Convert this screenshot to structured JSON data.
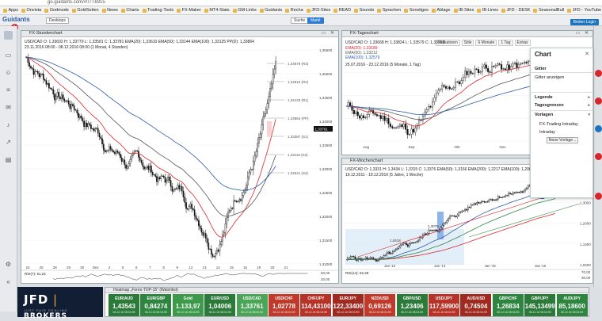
{
  "browser": {
    "url": "go.guidants.com/#!/7T6915",
    "bookmarks": [
      "Apps",
      "Onvista",
      "Godmode",
      "GoldSeiten",
      "News",
      "Charts",
      "Trading-Tools",
      "FX-Maker",
      "MT4-Stats",
      "GM-Links",
      "Guidants",
      "Recha",
      "JFD-Sites",
      "READ",
      "Sounds",
      "Sprachen",
      "Sonstiges",
      "Ablage",
      "IB-Sites",
      "IB-Lines",
      "JFD - DESK",
      "SeasonalBull",
      "JFD - YouTube",
      "Live - YouTube",
      "Weitere"
    ]
  },
  "app": {
    "logo": "Guidants",
    "badge": "1",
    "desktop_label": "Desktops",
    "search_label": "Suche",
    "market_label": "Markt",
    "broker_btn": "Broker Login"
  },
  "h1": {
    "title": "FX-Stundenchart",
    "line1": "USD/CAD   O: 1,33602  H: 1,33779  L: 1,33581  C: 1,33781   EMA(20): 1,33610   EMA(50): 1,33144   EMA(100): 1,33125   PP(D): 1,33864",
    "line2": "23.11.2016 08:00 - 08.12.2016 08:00   (1 Monat, 4 Stunden)",
    "levels": [
      {
        "label": "1,34879 (R3)",
        "color": "#555"
      },
      {
        "label": "1,34610 (R2)",
        "color": "#555"
      },
      {
        "label": "1,34133 (R1)",
        "color": "#555"
      },
      {
        "label": "1,33864 (PP)",
        "color": "#555"
      },
      {
        "label": "1,33387 (S1)",
        "color": "#555"
      },
      {
        "label": "1,33118 (S2)",
        "color": "#555"
      },
      {
        "label": "1,32641 (S3)",
        "color": "#555"
      }
    ],
    "yaxis": [
      "1,35500",
      "1,35000",
      "1,34500",
      "1,34000",
      "1,33500",
      "1,33000",
      "1,32500",
      "1,32000",
      "1,31500",
      "1,31000"
    ],
    "price_tag": "1,33761",
    "xaxis": [
      "24",
      "25",
      "28",
      "29",
      "30",
      "Dez",
      "2",
      "5",
      "6",
      "7",
      "8",
      "9",
      "12",
      "13",
      "14",
      "15",
      "16",
      "19",
      "20",
      "21"
    ],
    "rsi": {
      "label": "RSI(7): 51,22",
      "scale": [
        "60,00",
        "20,00"
      ]
    }
  },
  "d1": {
    "title": "FX-Tageschart",
    "tools": [
      "Indikatoren",
      "Stile",
      "6 Monate",
      "1 Tag",
      "Extras"
    ],
    "line1": "USD/CAD   O: 1,33668  H: 1,33824  L: 1,33579  C: 1,33761",
    "ema_lines": [
      {
        "label": "EMA(20): 1,33189",
        "color": "#d9262c"
      },
      {
        "label": "EMA(50): 1,33212",
        "color": "#555"
      },
      {
        "label": "EMA(100): 1,32579",
        "color": "#2b5ca8"
      }
    ],
    "line2": "25.07.2016 - 23.12.2016 (5 Monate, 1 Tag)",
    "yaxis": [
      "1,36000",
      "1,34000",
      "1,32000",
      "1,30000",
      "1,28000"
    ],
    "price_tag": "1,33761",
    "tag2": "1,30640",
    "xaxis": [
      "Aug",
      "Sep",
      "Okt",
      "Nov",
      "Dez"
    ]
  },
  "w1": {
    "title": "FX-Wochenchart",
    "line1": "USD/CAD   O: 1,3331  H: 1,3434  L: 1,3315  C: 1,3376   EMA(50): 1,3166   EMA(200): 1,2217   EMA(100): 1,2084",
    "line2": "19.12.2011 - 19.12.2016  (5 Jahre, 1 Woche)",
    "yaxis": [
      "1,4000",
      "1,3000",
      "1,2000",
      "1,1000",
      "1,0000"
    ],
    "price_tag": "1,3376",
    "notes": [
      "1,0418",
      "1,3076"
    ],
    "xaxis": [
      "Jan '13",
      "Jan '14",
      "Jan '15",
      "Jan '16"
    ],
    "rsi": {
      "label": "RSI(14): 62,28",
      "scale": [
        "70,00",
        "30,00"
      ]
    }
  },
  "menu": {
    "title": "Chart",
    "items": [
      {
        "label": "Gitter",
        "chev": ""
      },
      {
        "label": "Gitter anzeigen",
        "chev": ""
      },
      {
        "label": "Legende",
        "chev": "▸"
      },
      {
        "label": "Tagesgrenzen",
        "chev": "▸"
      },
      {
        "label": "Vorlagen",
        "chev": "▾"
      },
      {
        "label": "FX-Trading Intraday",
        "chev": ""
      },
      {
        "label": "Intraday",
        "chev": ""
      }
    ],
    "button": "Neue Vorlage..."
  },
  "broker": {
    "name": "JFD",
    "name2": "BROKERS",
    "slogan": "JUST FAIR DEALING"
  },
  "heatmap": {
    "title": "Heatmap „Forex-TOP-15\" (Watchlist)",
    "tiles": [
      {
        "name": "EUR/AUD",
        "value": "1,43543",
        "sub": "08.12.16 08:04:59",
        "color": "#2b7a3a"
      },
      {
        "name": "EUR/GBP",
        "value": "0,84274",
        "sub": "08.12.16 08:04:59",
        "color": "#2e8540"
      },
      {
        "name": "Gold",
        "value": "1.133,97",
        "sub": "08.12.16 08:04:59",
        "color": "#3c9a4a"
      },
      {
        "name": "EUR/USD",
        "value": "1,04006",
        "sub": "08.12.16 08:04:59",
        "color": "#2b7a3a"
      },
      {
        "name": "USD/CAD",
        "value": "1,33761",
        "sub": "08.12.16 08:04:59",
        "color": "#4aa558"
      },
      {
        "name": "USD/CHF",
        "value": "1,02778",
        "sub": "08.12.16 08:04:59",
        "color": "#c0392b"
      },
      {
        "name": "CHF/JPY",
        "value": "114,43100",
        "sub": "08.12.16 08:04:59",
        "color": "#b83227"
      },
      {
        "name": "EUR/JPY",
        "value": "122,33400",
        "sub": "08.12.16 08:04:59",
        "color": "#a12a20"
      },
      {
        "name": "NZD/USD",
        "value": "0,69126",
        "sub": "08.12.16 08:04:59",
        "color": "#c0392b"
      },
      {
        "name": "GBP/USD",
        "value": "1,23406",
        "sub": "08.12.16 08:04:59",
        "color": "#2b7a3a"
      },
      {
        "name": "USD/JPY",
        "value": "117,59900",
        "sub": "08.12.16 08:04:59",
        "color": "#b83227"
      },
      {
        "name": "AUD/USD",
        "value": "0,74504",
        "sub": "08.12.16 08:04:59",
        "color": "#a12a20"
      },
      {
        "name": "GBP/CHF",
        "value": "1,26834",
        "sub": "08.12.16 08:04:59",
        "color": "#2e8540"
      },
      {
        "name": "GBP/JPY",
        "value": "145,13499",
        "sub": "08.12.16 08:04:59",
        "color": "#2b7a3a"
      },
      {
        "name": "AUD/JPY",
        "value": "85,18600",
        "sub": "08.12.16 08:04:59",
        "color": "#2e8540"
      }
    ]
  }
}
